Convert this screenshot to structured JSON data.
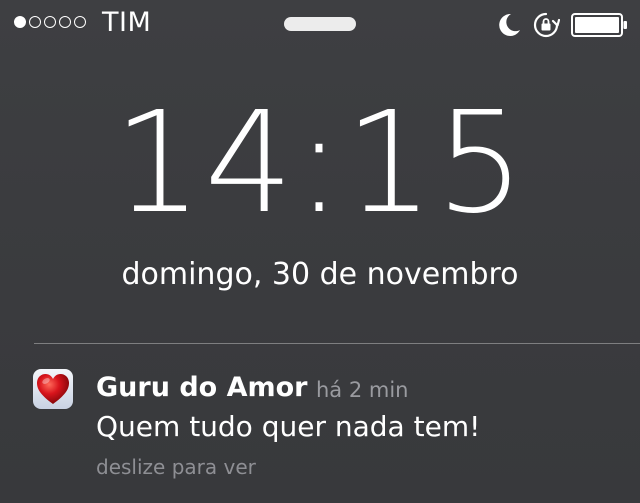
{
  "status_bar": {
    "signal_strength": 1,
    "signal_dots_total": 5,
    "carrier": "TIM",
    "icons": [
      "moon-icon",
      "rotation-lock-icon",
      "battery-icon"
    ],
    "battery_level": 1.0
  },
  "lock_screen": {
    "time": "14:15",
    "date": "domingo, 30 de novembro"
  },
  "notification": {
    "app_icon": "heart-icon",
    "app_name": "Guru do Amor",
    "time_ago": "há 2 min",
    "message": "Quem tudo quer nada tem!",
    "hint": "deslize para ver"
  },
  "colors": {
    "background": "#3c3d40",
    "text": "#ffffff",
    "secondary_text": "#9a9ba0",
    "heart": "#d8141c"
  }
}
